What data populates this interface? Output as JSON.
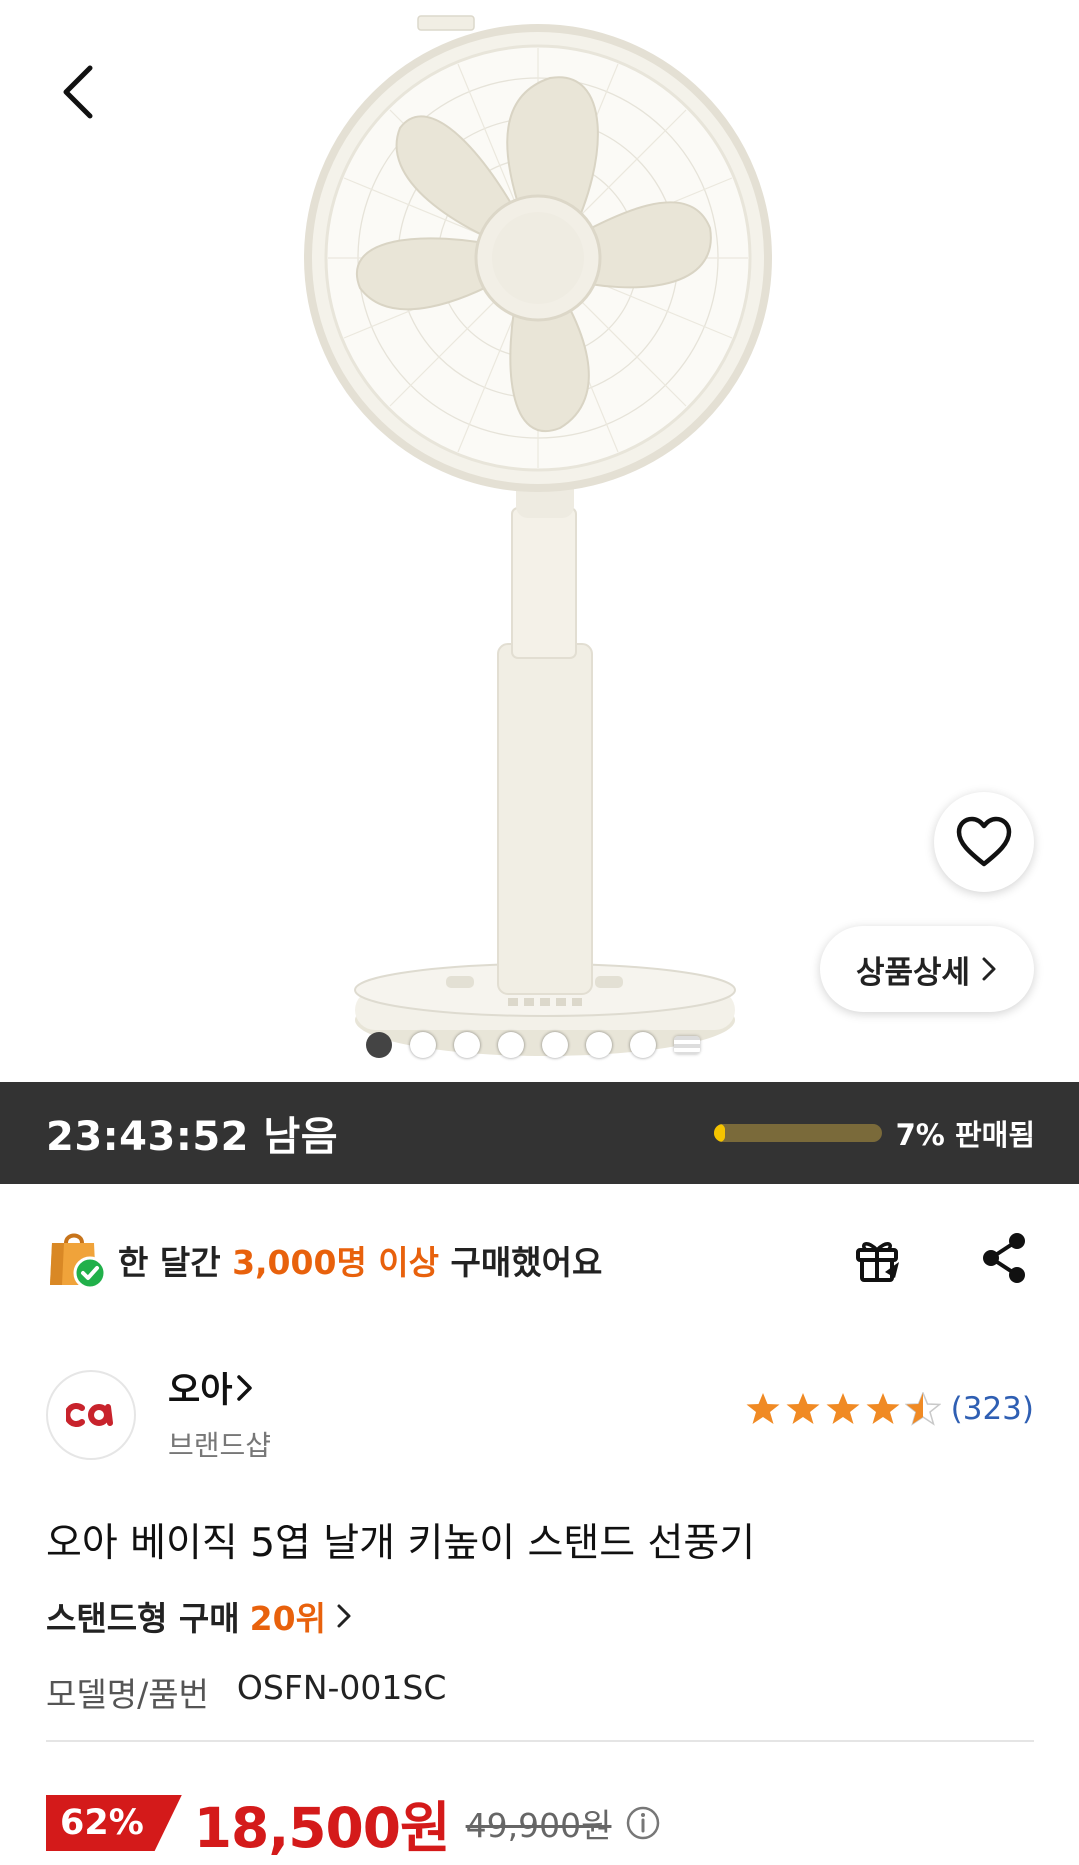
{
  "hero": {
    "detail_button_label": "상품상세",
    "pager": {
      "total": 8,
      "active_index": 0
    }
  },
  "timer": {
    "remaining_label": "23:43:52 남음",
    "sold_percent": 7,
    "sold_label": "7% 판매됨"
  },
  "purchase_info": {
    "prefix": "한 달간 ",
    "highlight": "3,000명 이상",
    "suffix": " 구매했어요"
  },
  "brand": {
    "logo_text": "oa",
    "name": "오아",
    "type": "브랜드샵",
    "rating": 4.5,
    "review_count": "(323)"
  },
  "product": {
    "title": "오아 베이직 5엽 날개 키높이 스탠드 선풍기",
    "rank_prefix": "스탠드형 구매",
    "rank_value": "20위",
    "model_label": "모델명/품번",
    "model_value": "OSFN-001SC"
  },
  "price": {
    "discount": "62%",
    "sale_price": "18,500원",
    "original_price": "49,900원"
  },
  "icons": {
    "back": "chevron-left-icon",
    "wish": "heart-icon",
    "gift": "gift-icon",
    "share": "share-icon",
    "info": "info-icon"
  },
  "colors": {
    "accent_orange": "#e8610c",
    "sale_red": "#d41a1a",
    "timer_bg": "#333333",
    "progress_fill": "#f5c400",
    "review_blue": "#2f5fb3",
    "star": "#f08a24"
  }
}
